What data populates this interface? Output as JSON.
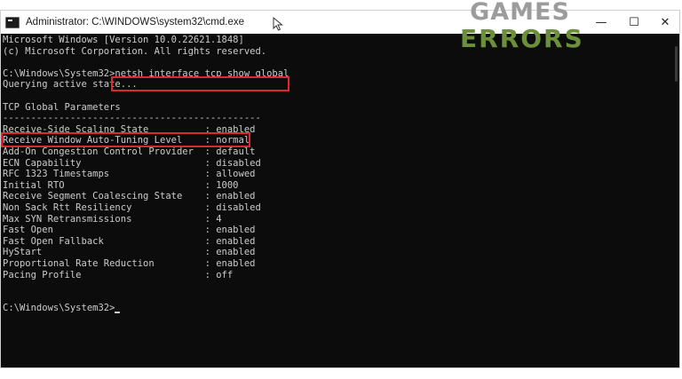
{
  "window": {
    "title": "Administrator: C:\\WINDOWS\\system32\\cmd.exe",
    "minimize_glyph": "—",
    "maximize_glyph": "☐",
    "close_glyph": "✕"
  },
  "watermark": {
    "line1": "GAMES",
    "line2": "ERRORS"
  },
  "console": {
    "lines": [
      "Microsoft Windows [Version 10.0.22621.1848]",
      "(c) Microsoft Corporation. All rights reserved.",
      "",
      "C:\\Windows\\System32>netsh interface tcp show global",
      "Querying active state...",
      "",
      "TCP Global Parameters",
      "----------------------------------------------",
      "Receive-Side Scaling State          : enabled",
      "Receive Window Auto-Tuning Level    : normal",
      "Add-On Congestion Control Provider  : default",
      "ECN Capability                      : disabled",
      "RFC 1323 Timestamps                 : allowed",
      "Initial RTO                         : 1000",
      "Receive Segment Coalescing State    : enabled",
      "Non Sack Rtt Resiliency             : disabled",
      "Max SYN Retransmissions             : 4",
      "Fast Open                           : enabled",
      "Fast Open Fallback                  : enabled",
      "HyStart                             : enabled",
      "Proportional Rate Reduction         : enabled",
      "Pacing Profile                      : off",
      "",
      "",
      "C:\\Windows\\System32>"
    ]
  },
  "colors": {
    "console_bg": "#0c0c0c",
    "console_text": "#cccccc",
    "highlight_border": "#e0262f",
    "watermark_games": "#9c9c9c",
    "watermark_errors": "#6b8f3a"
  },
  "icons": {
    "app": "cmd-app-icon",
    "cursor": "mouse-pointer-icon"
  }
}
